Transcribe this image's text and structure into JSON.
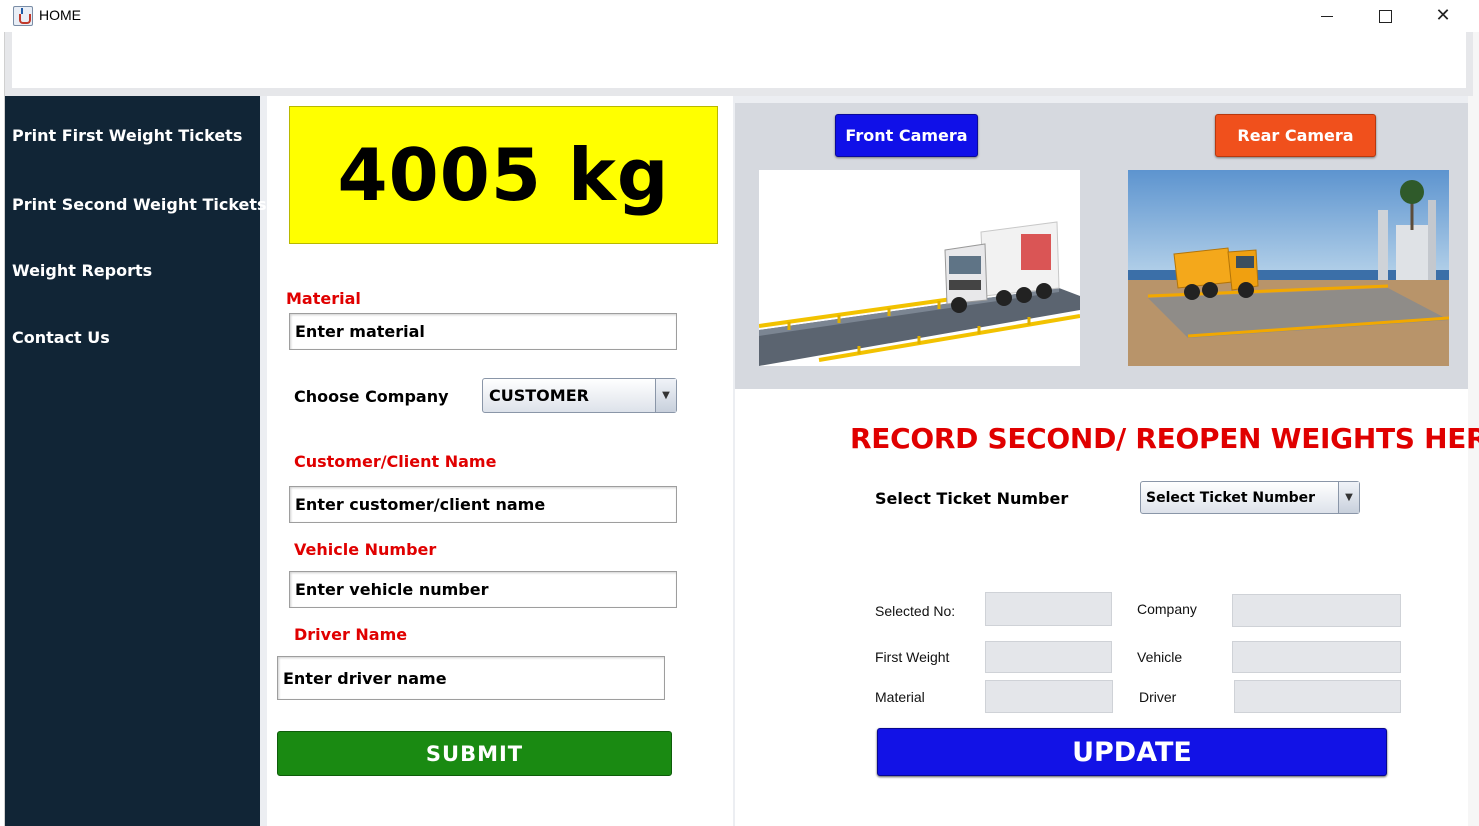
{
  "window": {
    "title": "HOME",
    "controls": {
      "minimize": "—",
      "maximize": "☐",
      "close": "✕"
    }
  },
  "sidebar": {
    "items": [
      {
        "label": "Print First Weight Tickets"
      },
      {
        "label": "Print Second Weight Tickets"
      },
      {
        "label": "Weight Reports"
      },
      {
        "label": "Contact Us"
      }
    ],
    "background": "#112536"
  },
  "weight": {
    "display": "4005 kg",
    "background": "#ffff00"
  },
  "form": {
    "material_label": "Material",
    "material_placeholder": "Enter material",
    "company_label": "Choose Company",
    "company_selected": "CUSTOMER",
    "customer_label": "Customer/Client Name",
    "customer_placeholder": "Enter customer/client name",
    "vehicle_label": "Vehicle Number",
    "vehicle_placeholder": "Enter vehicle number",
    "driver_label": "Driver Name",
    "driver_placeholder": "Enter driver name",
    "submit_label": "SUBMIT",
    "submit_color": "#1a8a12"
  },
  "cameras": {
    "front_label": "Front Camera",
    "front_color": "#1010e8",
    "rear_label": "Rear Camera",
    "rear_color": "#f0501c"
  },
  "record": {
    "heading": "RECORD SECOND/ REOPEN WEIGHTS HERE",
    "ticket_label": "Select Ticket Number",
    "ticket_selected": "Select Ticket Number",
    "fields": {
      "selected_no": "Selected No:",
      "company": "Company",
      "first_weight": "First Weight",
      "vehicle": "Vehicle",
      "material": "Material",
      "driver": "Driver"
    },
    "update_label": "UPDATE",
    "update_color": "#1212e6"
  }
}
